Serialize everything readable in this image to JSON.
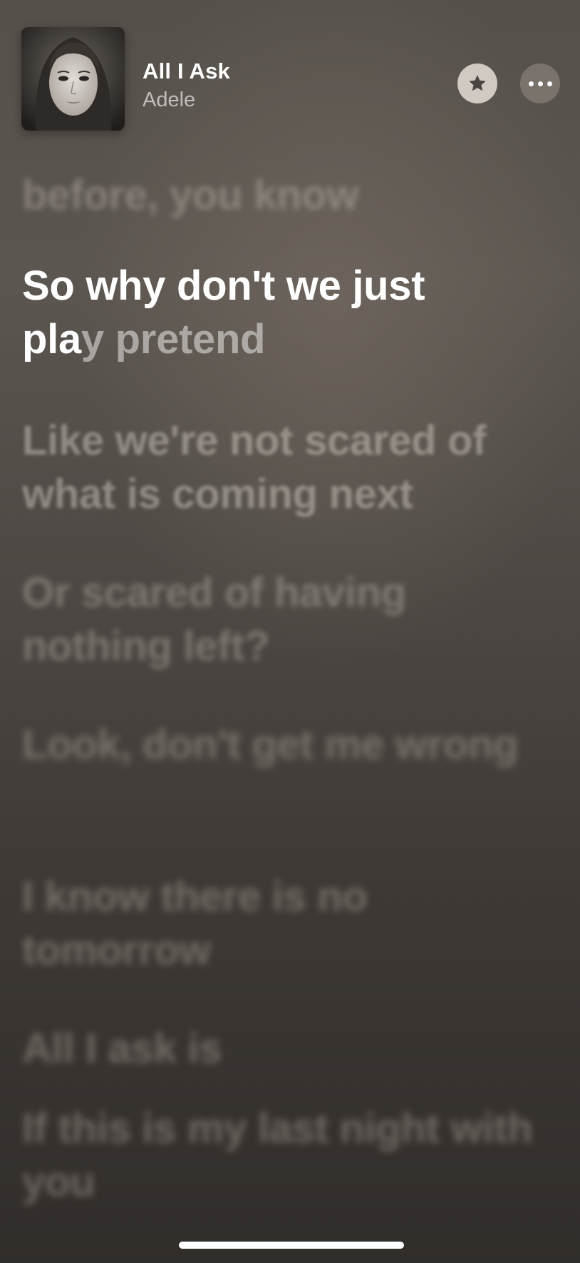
{
  "now_playing": {
    "title": "All I Ask",
    "artist": "Adele"
  },
  "buttons": {
    "favorite_icon": "star-icon",
    "more_icon": "ellipsis-icon"
  },
  "lyrics": {
    "previous": "before, you know",
    "current_line1": "So why don't we just",
    "current_line2_sung": "pla",
    "current_line2_unsung": "y pretend",
    "upcoming": [
      "Like we're not scared of what is coming next",
      "Or scared of having nothing left?",
      "Look, don't get me wrong",
      "I know there is no tomorrow",
      "All I ask is",
      "If this is my last night with you"
    ]
  },
  "colors": {
    "background_top": "#55504a",
    "background_bottom": "#312d2a",
    "active_lyric": "#ffffff"
  }
}
